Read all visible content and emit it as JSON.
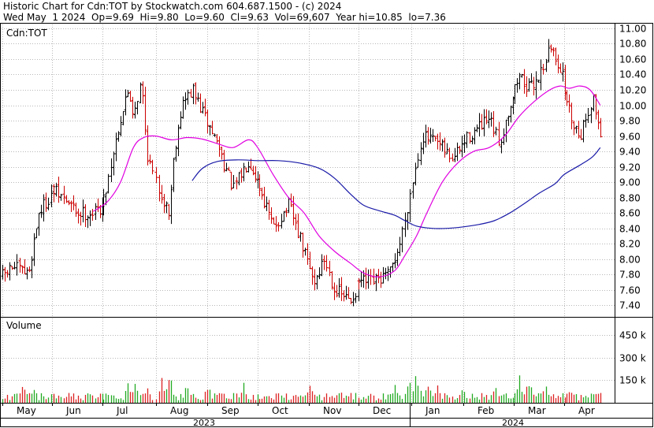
{
  "header": {
    "line1": "Historic Chart for Cdn:TOT by Stockwatch.com 604.687.1500 - (c) 2024",
    "line2": "Wed May  1 2024  Op=9.69  Hi=9.80  Lo=9.60  Cl=9.63  Vol=69,607  Year hi=10.85  lo=7.36"
  },
  "colors": {
    "up_bar": "#000000",
    "down_bar": "#cc0000",
    "ma_short": "#e000e0",
    "ma_long": "#1a1aa8",
    "vol_up": "#22aa22",
    "vol_down": "#dd2222",
    "grid": "#b8b8b8"
  },
  "chart_data": [
    {
      "type": "ohlc",
      "title": "Cdn:TOT",
      "y_ticks": [
        "11.00",
        "10.80",
        "10.60",
        "10.40",
        "10.20",
        "10.00",
        "9.80",
        "9.60",
        "9.40",
        "9.20",
        "9.00",
        "8.80",
        "8.60",
        "8.40",
        "8.20",
        "8.00",
        "7.80",
        "7.60",
        "7.40"
      ],
      "ylim": [
        7.25,
        11.05
      ],
      "x_months": [
        "May",
        "Jun",
        "Jul",
        "Aug",
        "Sep",
        "Oct",
        "Nov",
        "Dec",
        "Jan",
        "Feb",
        "Mar",
        "Apr"
      ],
      "x_years": [
        "2023",
        "2024"
      ],
      "grid": true,
      "closing_price_path": [
        {
          "x": 0.0,
          "y": 7.78
        },
        {
          "x": 0.2,
          "y": 7.9
        },
        {
          "x": 0.5,
          "y": 7.8
        },
        {
          "x": 0.7,
          "y": 8.6
        },
        {
          "x": 1.0,
          "y": 8.9
        },
        {
          "x": 1.2,
          "y": 8.8
        },
        {
          "x": 1.5,
          "y": 8.6
        },
        {
          "x": 1.8,
          "y": 8.6
        },
        {
          "x": 2.0,
          "y": 8.7
        },
        {
          "x": 2.15,
          "y": 9.2
        },
        {
          "x": 2.3,
          "y": 9.7
        },
        {
          "x": 2.5,
          "y": 10.2
        },
        {
          "x": 2.6,
          "y": 9.9
        },
        {
          "x": 2.75,
          "y": 10.3
        },
        {
          "x": 2.85,
          "y": 9.4
        },
        {
          "x": 3.0,
          "y": 9.0
        },
        {
          "x": 3.25,
          "y": 8.6
        },
        {
          "x": 3.35,
          "y": 9.4
        },
        {
          "x": 3.5,
          "y": 10.0
        },
        {
          "x": 3.7,
          "y": 10.2
        },
        {
          "x": 3.9,
          "y": 9.9
        },
        {
          "x": 4.2,
          "y": 9.5
        },
        {
          "x": 4.5,
          "y": 8.9
        },
        {
          "x": 4.8,
          "y": 9.3
        },
        {
          "x": 5.0,
          "y": 9.0
        },
        {
          "x": 5.3,
          "y": 8.4
        },
        {
          "x": 5.6,
          "y": 8.7
        },
        {
          "x": 5.9,
          "y": 8.1
        },
        {
          "x": 6.1,
          "y": 7.7
        },
        {
          "x": 6.3,
          "y": 8.0
        },
        {
          "x": 6.5,
          "y": 7.6
        },
        {
          "x": 6.8,
          "y": 7.45
        },
        {
          "x": 7.0,
          "y": 7.7
        },
        {
          "x": 7.3,
          "y": 7.7
        },
        {
          "x": 7.6,
          "y": 7.8
        },
        {
          "x": 7.8,
          "y": 8.2
        },
        {
          "x": 8.0,
          "y": 8.9
        },
        {
          "x": 8.2,
          "y": 9.6
        },
        {
          "x": 8.5,
          "y": 9.5
        },
        {
          "x": 8.8,
          "y": 9.3
        },
        {
          "x": 9.1,
          "y": 9.6
        },
        {
          "x": 9.5,
          "y": 9.8
        },
        {
          "x": 9.7,
          "y": 9.5
        },
        {
          "x": 9.9,
          "y": 10.0
        },
        {
          "x": 10.1,
          "y": 10.4
        },
        {
          "x": 10.3,
          "y": 10.2
        },
        {
          "x": 10.5,
          "y": 10.4
        },
        {
          "x": 10.7,
          "y": 10.75
        },
        {
          "x": 10.9,
          "y": 10.5
        },
        {
          "x": 11.1,
          "y": 9.9
        },
        {
          "x": 11.3,
          "y": 9.6
        },
        {
          "x": 11.55,
          "y": 10.1
        },
        {
          "x": 11.7,
          "y": 9.63
        }
      ],
      "series": [
        {
          "kind": "moving_average_short",
          "points": [
            {
              "x": 1.8,
              "y": 8.62
            },
            {
              "x": 2.1,
              "y": 8.75
            },
            {
              "x": 2.35,
              "y": 9.0
            },
            {
              "x": 2.6,
              "y": 9.45
            },
            {
              "x": 2.8,
              "y": 9.58
            },
            {
              "x": 3.0,
              "y": 9.6
            },
            {
              "x": 3.3,
              "y": 9.55
            },
            {
              "x": 3.6,
              "y": 9.58
            },
            {
              "x": 3.9,
              "y": 9.56
            },
            {
              "x": 4.2,
              "y": 9.5
            },
            {
              "x": 4.5,
              "y": 9.45
            },
            {
              "x": 4.8,
              "y": 9.55
            },
            {
              "x": 5.0,
              "y": 9.45
            },
            {
              "x": 5.3,
              "y": 9.1
            },
            {
              "x": 5.6,
              "y": 8.8
            },
            {
              "x": 5.9,
              "y": 8.6
            },
            {
              "x": 6.2,
              "y": 8.3
            },
            {
              "x": 6.5,
              "y": 8.1
            },
            {
              "x": 6.8,
              "y": 7.95
            },
            {
              "x": 7.1,
              "y": 7.82
            },
            {
              "x": 7.4,
              "y": 7.77
            },
            {
              "x": 7.7,
              "y": 7.85
            },
            {
              "x": 7.9,
              "y": 8.05
            },
            {
              "x": 8.1,
              "y": 8.3
            },
            {
              "x": 8.3,
              "y": 8.6
            },
            {
              "x": 8.6,
              "y": 9.0
            },
            {
              "x": 8.9,
              "y": 9.25
            },
            {
              "x": 9.2,
              "y": 9.4
            },
            {
              "x": 9.5,
              "y": 9.45
            },
            {
              "x": 9.8,
              "y": 9.6
            },
            {
              "x": 10.1,
              "y": 9.85
            },
            {
              "x": 10.4,
              "y": 10.05
            },
            {
              "x": 10.7,
              "y": 10.2
            },
            {
              "x": 10.9,
              "y": 10.25
            },
            {
              "x": 11.1,
              "y": 10.22
            },
            {
              "x": 11.3,
              "y": 10.25
            },
            {
              "x": 11.5,
              "y": 10.2
            },
            {
              "x": 11.7,
              "y": 10.0
            }
          ]
        },
        {
          "kind": "moving_average_long",
          "points": [
            {
              "x": 3.7,
              "y": 9.02
            },
            {
              "x": 3.9,
              "y": 9.18
            },
            {
              "x": 4.2,
              "y": 9.27
            },
            {
              "x": 4.6,
              "y": 9.29
            },
            {
              "x": 5.0,
              "y": 9.28
            },
            {
              "x": 5.4,
              "y": 9.28
            },
            {
              "x": 5.8,
              "y": 9.25
            },
            {
              "x": 6.2,
              "y": 9.18
            },
            {
              "x": 6.5,
              "y": 9.05
            },
            {
              "x": 6.8,
              "y": 8.85
            },
            {
              "x": 7.1,
              "y": 8.7
            },
            {
              "x": 7.4,
              "y": 8.63
            },
            {
              "x": 7.7,
              "y": 8.57
            },
            {
              "x": 7.9,
              "y": 8.5
            },
            {
              "x": 8.1,
              "y": 8.43
            },
            {
              "x": 8.4,
              "y": 8.4
            },
            {
              "x": 8.7,
              "y": 8.4
            },
            {
              "x": 9.0,
              "y": 8.42
            },
            {
              "x": 9.3,
              "y": 8.45
            },
            {
              "x": 9.6,
              "y": 8.5
            },
            {
              "x": 9.9,
              "y": 8.6
            },
            {
              "x": 10.2,
              "y": 8.72
            },
            {
              "x": 10.5,
              "y": 8.86
            },
            {
              "x": 10.8,
              "y": 8.98
            },
            {
              "x": 11.0,
              "y": 9.1
            },
            {
              "x": 11.3,
              "y": 9.22
            },
            {
              "x": 11.55,
              "y": 9.33
            },
            {
              "x": 11.7,
              "y": 9.45
            }
          ]
        }
      ]
    },
    {
      "type": "bar",
      "title": "Volume",
      "y_ticks": [
        "450 k",
        "300 k",
        "150 k"
      ],
      "ylim": [
        0,
        560
      ],
      "unit": "k",
      "bar_count": 250,
      "baseline": 45,
      "spikes": [
        {
          "x": 0.4,
          "v": 130
        },
        {
          "x": 0.6,
          "v": 90
        },
        {
          "x": 1.3,
          "v": 70
        },
        {
          "x": 2.5,
          "v": 150
        },
        {
          "x": 2.65,
          "v": 170
        },
        {
          "x": 2.85,
          "v": 130
        },
        {
          "x": 3.1,
          "v": 160
        },
        {
          "x": 3.25,
          "v": 240
        },
        {
          "x": 3.6,
          "v": 140
        },
        {
          "x": 4.0,
          "v": 120
        },
        {
          "x": 4.7,
          "v": 140
        },
        {
          "x": 5.4,
          "v": 90
        },
        {
          "x": 6.0,
          "v": 150
        },
        {
          "x": 6.6,
          "v": 80
        },
        {
          "x": 7.7,
          "v": 130
        },
        {
          "x": 7.95,
          "v": 180
        },
        {
          "x": 8.1,
          "v": 200
        },
        {
          "x": 8.3,
          "v": 160
        },
        {
          "x": 8.5,
          "v": 140
        },
        {
          "x": 9.0,
          "v": 120
        },
        {
          "x": 9.6,
          "v": 140
        },
        {
          "x": 10.1,
          "v": 180
        },
        {
          "x": 10.3,
          "v": 190
        },
        {
          "x": 10.6,
          "v": 120
        },
        {
          "x": 11.1,
          "v": 90
        },
        {
          "x": 11.6,
          "v": 80
        }
      ]
    }
  ]
}
